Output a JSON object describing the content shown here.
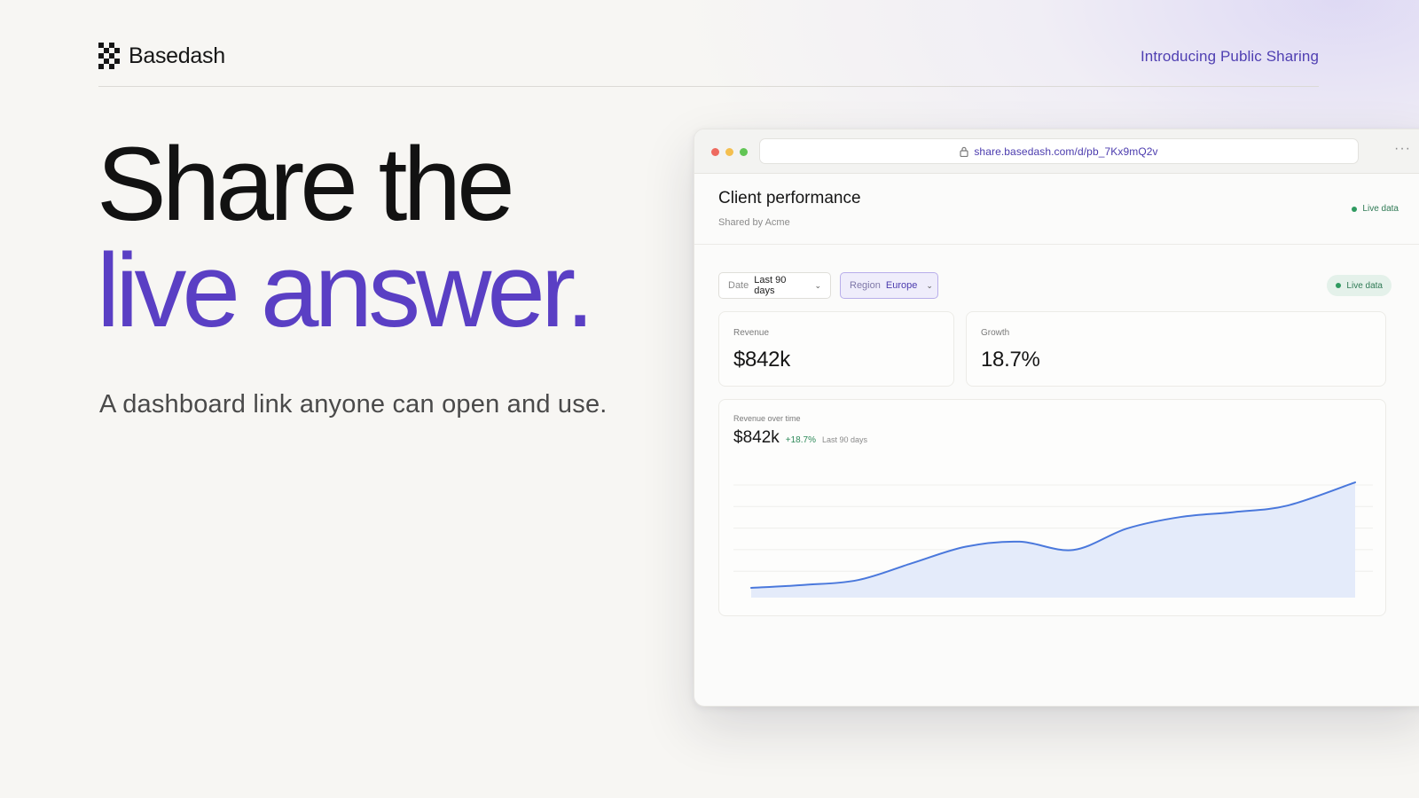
{
  "header": {
    "brand_name": "Basedash",
    "brand_icon": "checkerboard-logo-icon",
    "announcement_link": "Introducing Public Sharing"
  },
  "hero": {
    "line1": "Share the",
    "line2": "live answer.",
    "subtitle": "A dashboard link anyone can open and use."
  },
  "browser": {
    "url": "share.basedash.com/d/pb_7Kx9mQ2v",
    "more_icon": "more-icon"
  },
  "dashboard": {
    "title": "Client performance",
    "shared_by": "Shared by Acme",
    "live_label_top": "Live data",
    "filters": {
      "date": {
        "key": "Date",
        "value": "Last 90 days"
      },
      "region": {
        "key": "Region",
        "value": "Europe"
      }
    },
    "live_pill": "Live data",
    "cards": {
      "revenue": {
        "label": "Revenue",
        "value": "$842k"
      },
      "growth": {
        "label": "Growth",
        "value": "18.7%"
      }
    },
    "chart_card": {
      "label": "Revenue over time",
      "value": "$842k",
      "delta": "+18.7%",
      "period": "Last 90 days"
    }
  },
  "colors": {
    "accent": "#5a3fc4",
    "link": "#4f3fb2",
    "chart_line": "#4a78dc",
    "chart_fill": "#e4ebfa",
    "live_green": "#2f9a60"
  },
  "chart_data": {
    "type": "area",
    "title": "Revenue over time",
    "x": [
      0,
      8,
      16,
      24,
      32,
      40,
      48,
      56,
      64,
      72,
      80,
      90
    ],
    "values": [
      0.1,
      0.28,
      0.58,
      1.6,
      2.6,
      2.9,
      2.4,
      3.7,
      4.4,
      4.7,
      5.1,
      6.5
    ],
    "ylim": [
      -0.6,
      7.2
    ],
    "grid": true,
    "legend": "none"
  }
}
